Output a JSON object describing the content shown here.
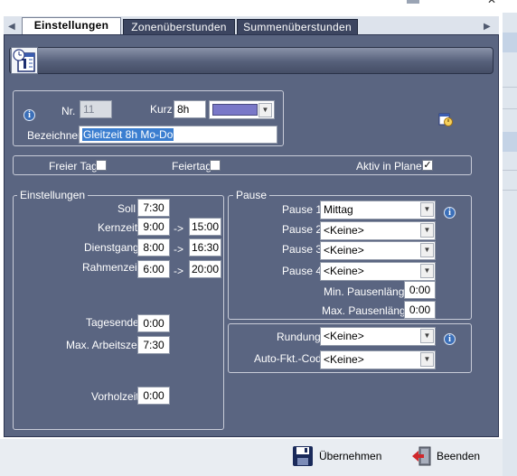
{
  "tabs": [
    {
      "label": "Einstellungen",
      "active": true
    },
    {
      "label": "Zonenüberstunden",
      "active": false
    },
    {
      "label": "Summenüberstunden",
      "active": false
    }
  ],
  "header": {
    "icon": "calendar-clock-icon"
  },
  "identity": {
    "nr_label": "Nr.",
    "nr_value": "11",
    "kurz_label": "Kurz",
    "kurz_value": "8h",
    "color_swatch": "#7a78c8",
    "bezeichner_label": "Bezeichner",
    "bezeichner_value": "Gleitzeit 8h Mo-Do"
  },
  "flags": {
    "freier_tag_label": "Freier Tag",
    "freier_tag_checked": false,
    "feiertag_label": "Feiertag",
    "feiertag_checked": false,
    "aktiv_label": "Aktiv in Planer",
    "aktiv_checked": true,
    "check_mark": "✓"
  },
  "settings": {
    "legend": "Einstellungen",
    "soll_label": "Soll",
    "soll_value": "7:30",
    "kernzeit_label": "Kernzeit",
    "kernzeit_from": "9:00",
    "kernzeit_to": "15:00",
    "dienstgang_label": "Dienstgang",
    "dienstgang_from": "8:00",
    "dienstgang_to": "16:30",
    "rahmenzeit_label": "Rahmenzeit",
    "rahmenzeit_from": "6:00",
    "rahmenzeit_to": "20:00",
    "arrow": "->",
    "tagesende_label": "Tagesende",
    "tagesende_value": "0:00",
    "max_arbeitszeit_label": "Max. Arbeitszeit",
    "max_arbeitszeit_value": "7:30",
    "vorholzeit_label": "Vorholzeit",
    "vorholzeit_value": "0:00"
  },
  "pause": {
    "legend": "Pause",
    "pause1_label": "Pause 1",
    "pause1_value": "Mittag",
    "pause2_label": "Pause 2",
    "pause2_value": "<Keine>",
    "pause3_label": "Pause 3",
    "pause3_value": "<Keine>",
    "pause4_label": "Pause 4",
    "pause4_value": "<Keine>",
    "min_label": "Min. Pausenlänge",
    "min_value": "0:00",
    "max_label": "Max. Pausenlänge",
    "max_value": "0:00"
  },
  "rounding": {
    "rundung_label": "Rundung",
    "rundung_value": "<Keine>",
    "autofkt_label": "Auto-Fkt.-Code",
    "autofkt_value": "<Keine>"
  },
  "footer": {
    "apply_label": "Übernehmen",
    "exit_label": "Beenden"
  },
  "window": {
    "close_glyph": "✕"
  }
}
